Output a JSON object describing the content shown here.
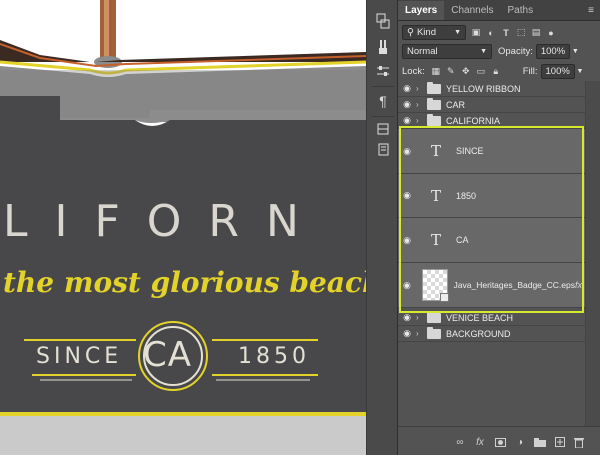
{
  "artwork": {
    "title_text": "LIFORN",
    "tagline": "the most glorious beach on th",
    "since_text": "SINCE",
    "ca_text": "CA",
    "year_text": "1850",
    "colors": {
      "charcoal": "#48484a",
      "yellow": "#e3d22a",
      "cream": "#e4e0d4",
      "grey": "#8a8a8a",
      "paper": "#cfcfcf"
    }
  },
  "panel": {
    "tabs": [
      {
        "label": "Layers",
        "active": true
      },
      {
        "label": "Channels",
        "active": false
      },
      {
        "label": "Paths",
        "active": false
      }
    ],
    "filter_kind": "Kind",
    "blend_mode": "Normal",
    "opacity_label": "Opacity:",
    "opacity_value": "100%",
    "lock_label": "Lock:",
    "fill_label": "Fill:",
    "fill_value": "100%",
    "layers": [
      {
        "type": "group",
        "name": "YELLOW RIBBON"
      },
      {
        "type": "group",
        "name": "CAR"
      },
      {
        "type": "group",
        "name": "CALIFORNIA"
      },
      {
        "type": "text",
        "name": "SINCE",
        "selected": true
      },
      {
        "type": "text",
        "name": "1850",
        "selected": true
      },
      {
        "type": "text",
        "name": "CA",
        "selected": true
      },
      {
        "type": "smart",
        "name": "Java_Heritages_Badge_CC.eps",
        "selected": true,
        "fx": "fx"
      },
      {
        "type": "group",
        "name": "VENICE BEACH"
      },
      {
        "type": "group",
        "name": "BACKGROUND"
      }
    ],
    "accent_color": "#d4ea2b"
  }
}
